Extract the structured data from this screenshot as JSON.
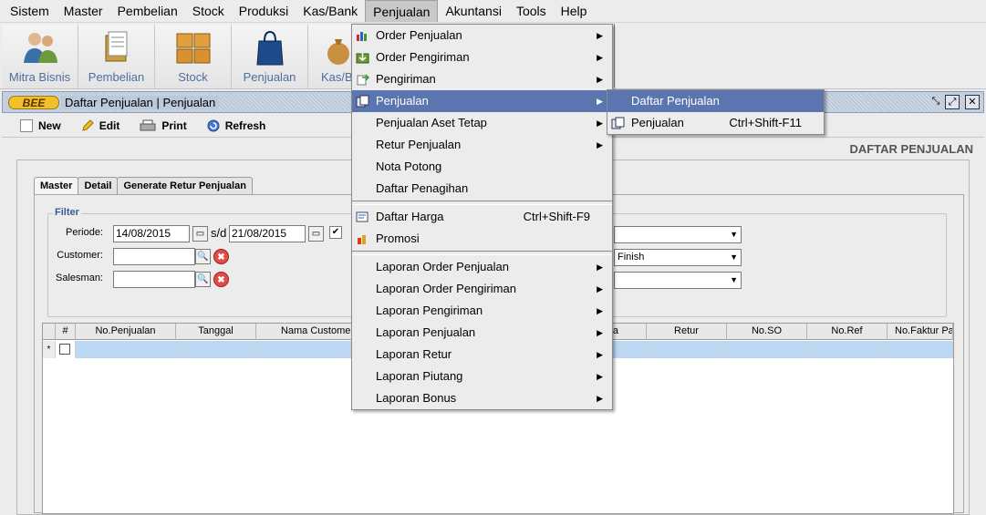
{
  "menubar": {
    "items": [
      "Sistem",
      "Master",
      "Pembelian",
      "Stock",
      "Produksi",
      "Kas/Bank",
      "Penjualan",
      "Akuntansi",
      "Tools",
      "Help"
    ]
  },
  "toolbar": {
    "buttons": [
      "Mitra Bisnis",
      "Pembelian",
      "Stock",
      "Penjualan",
      "Kas/B"
    ]
  },
  "window": {
    "logo": "BEE",
    "title": "Daftar Penjualan | Penjualan",
    "heading": "DAFTAR PENJUALAN"
  },
  "actions": {
    "new": "New",
    "edit": "Edit",
    "print": "Print",
    "refresh": "Refresh"
  },
  "tabs": [
    "Master",
    "Detail",
    "Generate Retur Penjualan"
  ],
  "filter": {
    "legend": "Filter",
    "periode_label": "Periode:",
    "periode_from": "14/08/2015",
    "periode_sep": "s/d",
    "periode_to": "21/08/2015",
    "customer_label": "Customer:",
    "salesman_label": "Salesman:",
    "status_value": "Finish"
  },
  "grid": {
    "columns": [
      "#",
      "No.Penjualan",
      "Tanggal",
      "Nama Customer",
      "a",
      "Retur",
      "No.SO",
      "No.Ref",
      "No.Faktur Pa"
    ],
    "new_row_marker": "*"
  },
  "penjualan_menu": {
    "items": [
      {
        "label": "Order Penjualan",
        "submenu": true
      },
      {
        "label": "Order Pengiriman",
        "submenu": true
      },
      {
        "label": "Pengiriman",
        "submenu": true
      },
      {
        "label": "Penjualan",
        "submenu": true
      },
      {
        "label": "Penjualan Aset Tetap",
        "submenu": true
      },
      {
        "label": "Retur Penjualan",
        "submenu": true
      },
      {
        "label": "Nota Potong"
      },
      {
        "label": "Daftar Penagihan"
      },
      {
        "label": "Daftar Harga",
        "shortcut": "Ctrl+Shift-F9"
      },
      {
        "label": "Promosi"
      },
      {
        "label": "Laporan Order Penjualan",
        "submenu": true
      },
      {
        "label": "Laporan Order Pengiriman",
        "submenu": true
      },
      {
        "label": "Laporan Pengiriman",
        "submenu": true
      },
      {
        "label": "Laporan Penjualan",
        "submenu": true
      },
      {
        "label": "Laporan Retur",
        "submenu": true
      },
      {
        "label": "Laporan Piutang",
        "submenu": true
      },
      {
        "label": "Laporan Bonus",
        "submenu": true
      }
    ]
  },
  "penjualan_submenu": {
    "items": [
      {
        "label": "Daftar Penjualan"
      },
      {
        "label": "Penjualan",
        "shortcut": "Ctrl+Shift-F11"
      }
    ]
  },
  "icons": {
    "submenu_arrow": "▶",
    "dropdown_arrow": "▼",
    "search": "search-icon",
    "clear": "✖"
  }
}
